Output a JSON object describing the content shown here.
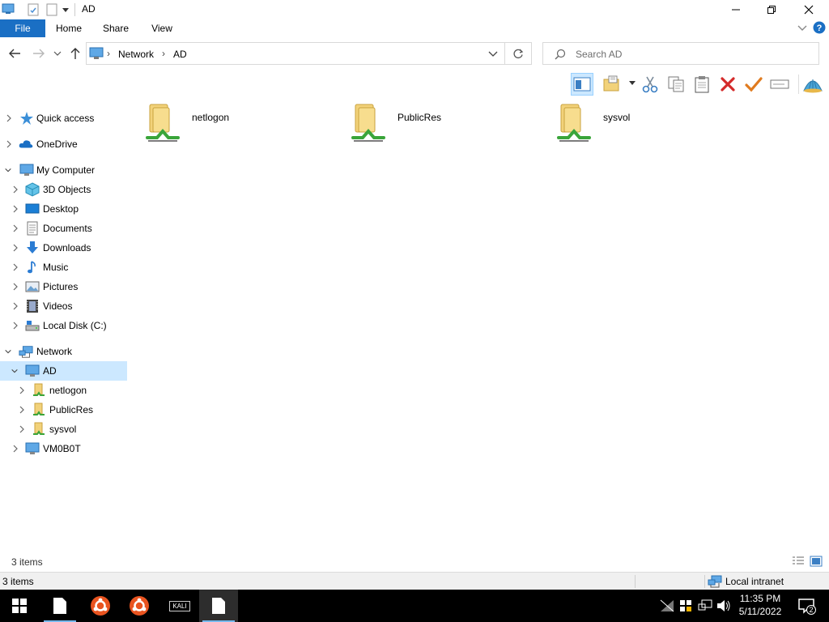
{
  "window": {
    "title": "AD"
  },
  "ribbon": {
    "tabs": [
      "File",
      "Home",
      "Share",
      "View"
    ]
  },
  "address": {
    "crumbs": [
      "Network",
      "AD"
    ],
    "separator": "›"
  },
  "search": {
    "placeholder": "Search AD"
  },
  "nav": {
    "quick_access": "Quick access",
    "onedrive": "OneDrive",
    "my_computer": "My Computer",
    "objects3d": "3D Objects",
    "desktop": "Desktop",
    "documents": "Documents",
    "downloads": "Downloads",
    "music": "Music",
    "pictures": "Pictures",
    "videos": "Videos",
    "local_disk": "Local Disk (C:)",
    "network": "Network",
    "ad": "AD",
    "netlogon": "netlogon",
    "publicres": "PublicRes",
    "sysvol": "sysvol",
    "vm": "VM0B0T"
  },
  "content": {
    "folders": [
      "netlogon",
      "PublicRes",
      "sysvol"
    ]
  },
  "status": {
    "item_count": "3 items",
    "bar_left": "3 items",
    "zone": "Local intranet"
  },
  "taskbar": {
    "time": "11:35 PM",
    "date": "5/11/2022",
    "kali_label": "KALI",
    "notif_count": "2"
  },
  "colors": {
    "accent": "#1a6fc4",
    "selection": "#cce8ff",
    "folder": "#f2d27a",
    "share_green": "#3aa53a"
  }
}
